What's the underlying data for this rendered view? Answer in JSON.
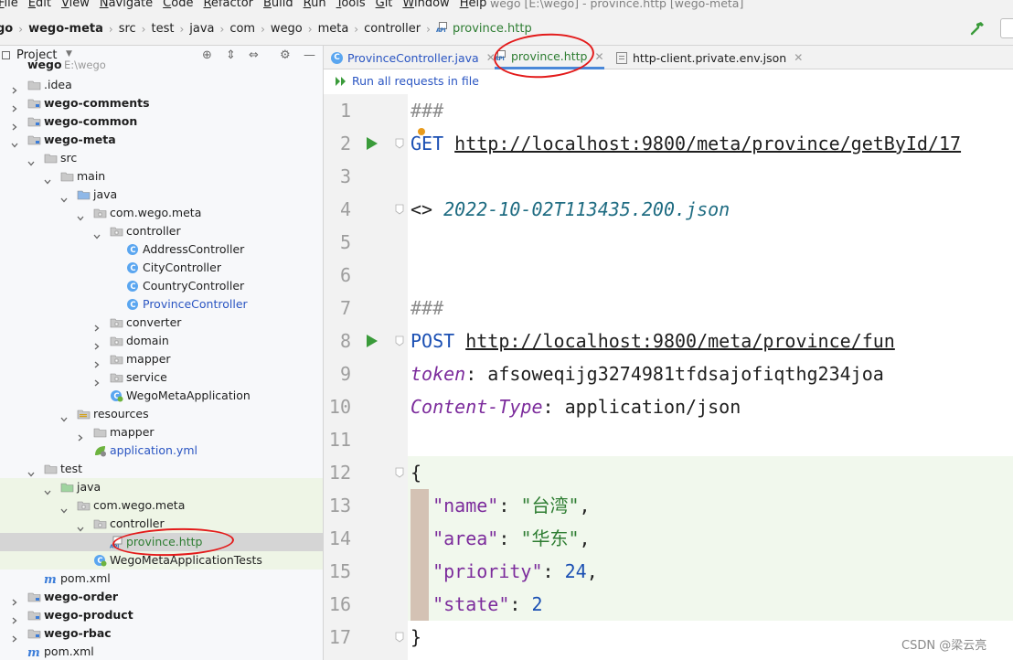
{
  "menubar": {
    "items": [
      "File",
      "Edit",
      "View",
      "Navigate",
      "Code",
      "Refactor",
      "Build",
      "Run",
      "Tools",
      "Git",
      "Window",
      "Help"
    ],
    "window_title": "wego [E:\\wego] - province.http [wego-meta]"
  },
  "breadcrumb": {
    "items": [
      "go",
      "wego-meta",
      "src",
      "test",
      "java",
      "com",
      "wego",
      "meta",
      "controller"
    ],
    "file": "province.http"
  },
  "project": {
    "title": "Project",
    "root_name": "wego",
    "root_path": "E:\\wego",
    "tree": [
      {
        "label": ".idea",
        "indent": 0,
        "type": "folder",
        "arrow": "right"
      },
      {
        "label": "wego-comments",
        "indent": 0,
        "type": "module",
        "arrow": "right",
        "bold": true
      },
      {
        "label": "wego-common",
        "indent": 0,
        "type": "module",
        "arrow": "right",
        "bold": true
      },
      {
        "label": "wego-meta",
        "indent": 0,
        "type": "module",
        "arrow": "down",
        "bold": true
      },
      {
        "label": "src",
        "indent": 1,
        "type": "folder",
        "arrow": "down"
      },
      {
        "label": "main",
        "indent": 2,
        "type": "folder",
        "arrow": "down"
      },
      {
        "label": "java",
        "indent": 3,
        "type": "src-folder",
        "arrow": "down"
      },
      {
        "label": "com.wego.meta",
        "indent": 4,
        "type": "package",
        "arrow": "down"
      },
      {
        "label": "controller",
        "indent": 5,
        "type": "package",
        "arrow": "down"
      },
      {
        "label": "AddressController",
        "indent": 6,
        "type": "class"
      },
      {
        "label": "CityController",
        "indent": 6,
        "type": "class"
      },
      {
        "label": "CountryController",
        "indent": 6,
        "type": "class"
      },
      {
        "label": "ProvinceController",
        "indent": 6,
        "type": "class",
        "blue": true
      },
      {
        "label": "converter",
        "indent": 5,
        "type": "package",
        "arrow": "right"
      },
      {
        "label": "domain",
        "indent": 5,
        "type": "package",
        "arrow": "right"
      },
      {
        "label": "mapper",
        "indent": 5,
        "type": "package",
        "arrow": "right"
      },
      {
        "label": "service",
        "indent": 5,
        "type": "package",
        "arrow": "right"
      },
      {
        "label": "WegoMetaApplication",
        "indent": 5,
        "type": "spring-class"
      },
      {
        "label": "resources",
        "indent": 3,
        "type": "res-folder",
        "arrow": "down"
      },
      {
        "label": "mapper",
        "indent": 4,
        "type": "folder",
        "arrow": "right"
      },
      {
        "label": "application.yml",
        "indent": 4,
        "type": "yml",
        "blue": true
      },
      {
        "label": "test",
        "indent": 1,
        "type": "folder",
        "arrow": "down"
      },
      {
        "label": "java",
        "indent": 2,
        "type": "test-folder",
        "arrow": "down",
        "test": true
      },
      {
        "label": "com.wego.meta",
        "indent": 3,
        "type": "package",
        "arrow": "down",
        "test": true
      },
      {
        "label": "controller",
        "indent": 4,
        "type": "package",
        "arrow": "down",
        "test": true
      },
      {
        "label": "province.http",
        "indent": 5,
        "type": "http",
        "selected": true,
        "green": true
      },
      {
        "label": "WegoMetaApplicationTests",
        "indent": 4,
        "type": "spring-class",
        "test": true
      },
      {
        "label": "pom.xml",
        "indent": 1,
        "type": "maven"
      },
      {
        "label": "wego-order",
        "indent": 0,
        "type": "module",
        "arrow": "right",
        "bold": true
      },
      {
        "label": "wego-product",
        "indent": 0,
        "type": "module",
        "arrow": "right",
        "bold": true
      },
      {
        "label": "wego-rbac",
        "indent": 0,
        "type": "module",
        "arrow": "right",
        "bold": true
      },
      {
        "label": "pom.xml",
        "indent": 0,
        "type": "maven"
      }
    ]
  },
  "editor": {
    "tabs": [
      {
        "label": "ProvinceController.java",
        "icon": "class",
        "active": false
      },
      {
        "label": "province.http",
        "icon": "http",
        "active": true
      },
      {
        "label": "http-client.private.env.json",
        "icon": "json",
        "active": false
      }
    ],
    "run_all_label": "Run all requests in file",
    "line_numbers": [
      "1",
      "2",
      "3",
      "4",
      "5",
      "6",
      "7",
      "8",
      "9",
      "10",
      "11",
      "12",
      "13",
      "14",
      "15",
      "16",
      "17"
    ],
    "lines": [
      [
        {
          "t": "###",
          "c": "k-comment"
        }
      ],
      [
        {
          "t": "GET",
          "c": "k-method"
        },
        {
          "t": " ",
          "c": "k-plain"
        },
        {
          "t": "http://localhost:9800/meta/province/getById/17",
          "c": "k-url"
        }
      ],
      [],
      [
        {
          "t": "<> ",
          "c": "k-plain"
        },
        {
          "t": "2022-10-02T113435.200.json",
          "c": "k-italic"
        }
      ],
      [],
      [],
      [
        {
          "t": "###",
          "c": "k-comment"
        }
      ],
      [
        {
          "t": "POST",
          "c": "k-method"
        },
        {
          "t": " ",
          "c": "k-plain"
        },
        {
          "t": "http://localhost:9800/meta/province/fun",
          "c": "k-url"
        }
      ],
      [
        {
          "t": "token",
          "c": "k-header"
        },
        {
          "t": ": afsoweqijg3274981tfdsajofiqthg234joa",
          "c": "k-plain"
        }
      ],
      [
        {
          "t": "Content-Type",
          "c": "k-header"
        },
        {
          "t": ": application/json",
          "c": "k-plain"
        }
      ],
      [],
      [
        {
          "t": "{",
          "c": "k-brace"
        }
      ],
      [
        {
          "t": "  ",
          "c": "k-plain"
        },
        {
          "t": "\"name\"",
          "c": "k-key"
        },
        {
          "t": ": ",
          "c": "k-plain"
        },
        {
          "t": "\"台湾\"",
          "c": "k-str"
        },
        {
          "t": ",",
          "c": "k-plain"
        }
      ],
      [
        {
          "t": "  ",
          "c": "k-plain"
        },
        {
          "t": "\"area\"",
          "c": "k-key"
        },
        {
          "t": ": ",
          "c": "k-plain"
        },
        {
          "t": "\"华东\"",
          "c": "k-str"
        },
        {
          "t": ",",
          "c": "k-plain"
        }
      ],
      [
        {
          "t": "  ",
          "c": "k-plain"
        },
        {
          "t": "\"priority\"",
          "c": "k-key"
        },
        {
          "t": ": ",
          "c": "k-plain"
        },
        {
          "t": "24",
          "c": "k-num"
        },
        {
          "t": ",",
          "c": "k-plain"
        }
      ],
      [
        {
          "t": "  ",
          "c": "k-plain"
        },
        {
          "t": "\"state\"",
          "c": "k-key"
        },
        {
          "t": ": ",
          "c": "k-plain"
        },
        {
          "t": "2",
          "c": "k-num"
        }
      ],
      [
        {
          "t": "}",
          "c": "k-brace"
        }
      ]
    ]
  },
  "watermark": "CSDN @梁云亮",
  "colors": {
    "accent": "#4a88d8",
    "annotation": "#e31b1b",
    "http_file": "#2e7d32",
    "run": "#3a9b3a"
  }
}
